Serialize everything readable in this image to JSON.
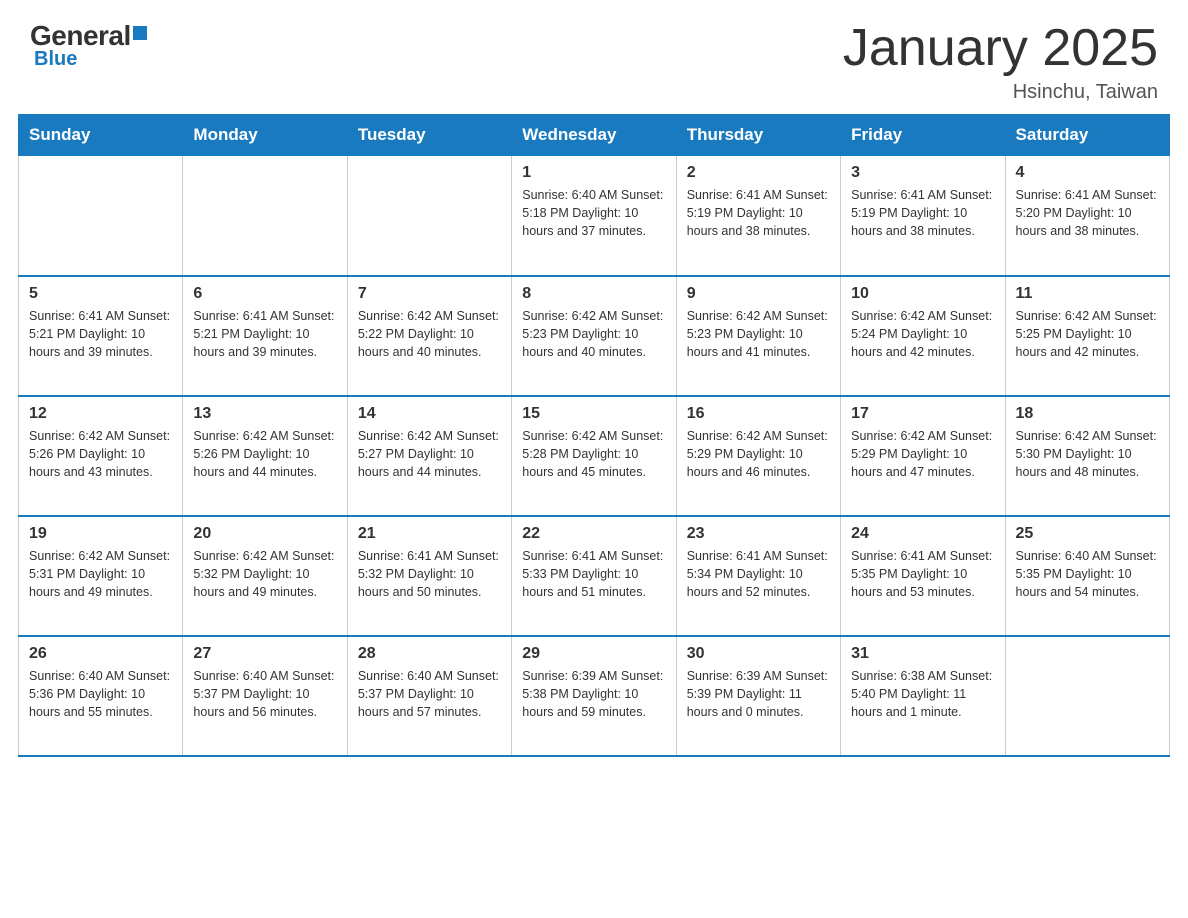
{
  "logo": {
    "general": "General",
    "blue": "Blue"
  },
  "title": "January 2025",
  "subtitle": "Hsinchu, Taiwan",
  "days_of_week": [
    "Sunday",
    "Monday",
    "Tuesday",
    "Wednesday",
    "Thursday",
    "Friday",
    "Saturday"
  ],
  "weeks": [
    [
      {
        "day": "",
        "info": ""
      },
      {
        "day": "",
        "info": ""
      },
      {
        "day": "",
        "info": ""
      },
      {
        "day": "1",
        "info": "Sunrise: 6:40 AM\nSunset: 5:18 PM\nDaylight: 10 hours\nand 37 minutes."
      },
      {
        "day": "2",
        "info": "Sunrise: 6:41 AM\nSunset: 5:19 PM\nDaylight: 10 hours\nand 38 minutes."
      },
      {
        "day": "3",
        "info": "Sunrise: 6:41 AM\nSunset: 5:19 PM\nDaylight: 10 hours\nand 38 minutes."
      },
      {
        "day": "4",
        "info": "Sunrise: 6:41 AM\nSunset: 5:20 PM\nDaylight: 10 hours\nand 38 minutes."
      }
    ],
    [
      {
        "day": "5",
        "info": "Sunrise: 6:41 AM\nSunset: 5:21 PM\nDaylight: 10 hours\nand 39 minutes."
      },
      {
        "day": "6",
        "info": "Sunrise: 6:41 AM\nSunset: 5:21 PM\nDaylight: 10 hours\nand 39 minutes."
      },
      {
        "day": "7",
        "info": "Sunrise: 6:42 AM\nSunset: 5:22 PM\nDaylight: 10 hours\nand 40 minutes."
      },
      {
        "day": "8",
        "info": "Sunrise: 6:42 AM\nSunset: 5:23 PM\nDaylight: 10 hours\nand 40 minutes."
      },
      {
        "day": "9",
        "info": "Sunrise: 6:42 AM\nSunset: 5:23 PM\nDaylight: 10 hours\nand 41 minutes."
      },
      {
        "day": "10",
        "info": "Sunrise: 6:42 AM\nSunset: 5:24 PM\nDaylight: 10 hours\nand 42 minutes."
      },
      {
        "day": "11",
        "info": "Sunrise: 6:42 AM\nSunset: 5:25 PM\nDaylight: 10 hours\nand 42 minutes."
      }
    ],
    [
      {
        "day": "12",
        "info": "Sunrise: 6:42 AM\nSunset: 5:26 PM\nDaylight: 10 hours\nand 43 minutes."
      },
      {
        "day": "13",
        "info": "Sunrise: 6:42 AM\nSunset: 5:26 PM\nDaylight: 10 hours\nand 44 minutes."
      },
      {
        "day": "14",
        "info": "Sunrise: 6:42 AM\nSunset: 5:27 PM\nDaylight: 10 hours\nand 44 minutes."
      },
      {
        "day": "15",
        "info": "Sunrise: 6:42 AM\nSunset: 5:28 PM\nDaylight: 10 hours\nand 45 minutes."
      },
      {
        "day": "16",
        "info": "Sunrise: 6:42 AM\nSunset: 5:29 PM\nDaylight: 10 hours\nand 46 minutes."
      },
      {
        "day": "17",
        "info": "Sunrise: 6:42 AM\nSunset: 5:29 PM\nDaylight: 10 hours\nand 47 minutes."
      },
      {
        "day": "18",
        "info": "Sunrise: 6:42 AM\nSunset: 5:30 PM\nDaylight: 10 hours\nand 48 minutes."
      }
    ],
    [
      {
        "day": "19",
        "info": "Sunrise: 6:42 AM\nSunset: 5:31 PM\nDaylight: 10 hours\nand 49 minutes."
      },
      {
        "day": "20",
        "info": "Sunrise: 6:42 AM\nSunset: 5:32 PM\nDaylight: 10 hours\nand 49 minutes."
      },
      {
        "day": "21",
        "info": "Sunrise: 6:41 AM\nSunset: 5:32 PM\nDaylight: 10 hours\nand 50 minutes."
      },
      {
        "day": "22",
        "info": "Sunrise: 6:41 AM\nSunset: 5:33 PM\nDaylight: 10 hours\nand 51 minutes."
      },
      {
        "day": "23",
        "info": "Sunrise: 6:41 AM\nSunset: 5:34 PM\nDaylight: 10 hours\nand 52 minutes."
      },
      {
        "day": "24",
        "info": "Sunrise: 6:41 AM\nSunset: 5:35 PM\nDaylight: 10 hours\nand 53 minutes."
      },
      {
        "day": "25",
        "info": "Sunrise: 6:40 AM\nSunset: 5:35 PM\nDaylight: 10 hours\nand 54 minutes."
      }
    ],
    [
      {
        "day": "26",
        "info": "Sunrise: 6:40 AM\nSunset: 5:36 PM\nDaylight: 10 hours\nand 55 minutes."
      },
      {
        "day": "27",
        "info": "Sunrise: 6:40 AM\nSunset: 5:37 PM\nDaylight: 10 hours\nand 56 minutes."
      },
      {
        "day": "28",
        "info": "Sunrise: 6:40 AM\nSunset: 5:37 PM\nDaylight: 10 hours\nand 57 minutes."
      },
      {
        "day": "29",
        "info": "Sunrise: 6:39 AM\nSunset: 5:38 PM\nDaylight: 10 hours\nand 59 minutes."
      },
      {
        "day": "30",
        "info": "Sunrise: 6:39 AM\nSunset: 5:39 PM\nDaylight: 11 hours\nand 0 minutes."
      },
      {
        "day": "31",
        "info": "Sunrise: 6:38 AM\nSunset: 5:40 PM\nDaylight: 11 hours\nand 1 minute."
      },
      {
        "day": "",
        "info": ""
      }
    ]
  ]
}
